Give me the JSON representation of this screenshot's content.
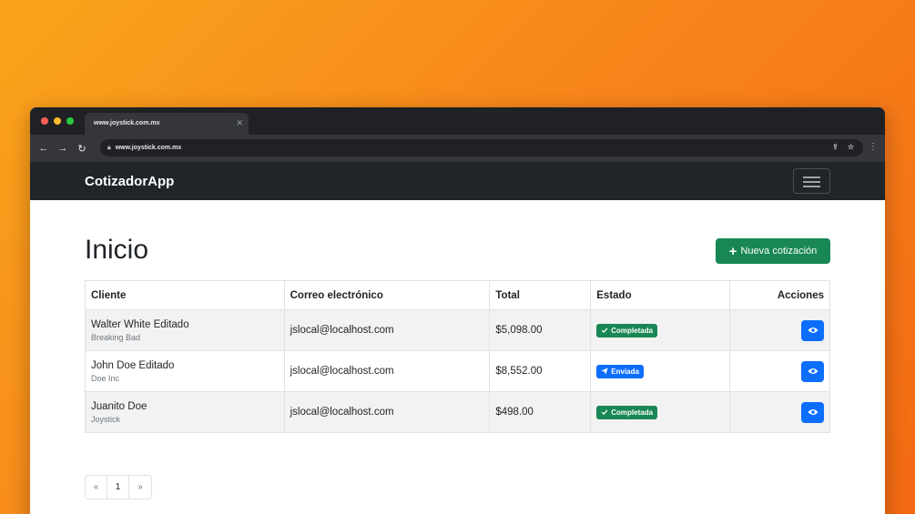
{
  "browser": {
    "tab_title": "www.joystick.com.mx",
    "url": "www.joystick.com.mx"
  },
  "navbar": {
    "brand": "CotizadorApp"
  },
  "page": {
    "title": "Inicio",
    "new_button": "Nueva cotización"
  },
  "table": {
    "headers": [
      "Cliente",
      "Correo electrónico",
      "Total",
      "Estado",
      "Acciones"
    ],
    "rows": [
      {
        "name": "Walter White Editado",
        "company": "Breaking Bad",
        "email": "jslocal@localhost.com",
        "total": "$5,098.00",
        "status": "Completada"
      },
      {
        "name": "John Doe Editado",
        "company": "Doe Inc",
        "email": "jslocal@localhost.com",
        "total": "$8,552.00",
        "status": "Enviada"
      },
      {
        "name": "Juanito Doe",
        "company": "Joystick",
        "email": "jslocal@localhost.com",
        "total": "$498.00",
        "status": "Completada"
      }
    ]
  },
  "pagination": {
    "prev": "«",
    "page": "1",
    "next": "»"
  },
  "colors": {
    "success": "#198754",
    "primary": "#0d6efd",
    "navbar": "#212529"
  }
}
